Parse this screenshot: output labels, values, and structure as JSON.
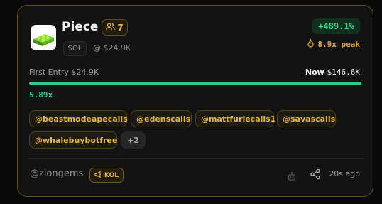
{
  "token": {
    "name": "Piece",
    "callers_count": "7",
    "chain": "SOL",
    "entry_mcap": "@ $24.9K",
    "pnl": "+489.1%",
    "peak": "8.9x peak"
  },
  "progress": {
    "first_entry": "First Entry $24.9K",
    "now_label": "Now",
    "now_value": "$146.6K",
    "multiple": "5.89x",
    "fill": 1.0
  },
  "channels": {
    "items": [
      "@beastmodeapecalls",
      "@edenscalls",
      "@mattfuriecalls1",
      "@savascalls",
      "@whalebuybotfree"
    ],
    "more": "+2"
  },
  "footer": {
    "author": "@ziongems",
    "badge": "KOL",
    "time": "20s ago"
  },
  "colors": {
    "accent_gold": "#e2b53f",
    "positive_green": "#34c98a",
    "card_border": "#5b5019"
  },
  "icons": {
    "callers": "users-icon",
    "peak": "flame-icon",
    "kol": "megaphone-icon",
    "bot": "bot-icon",
    "share": "share-icon"
  }
}
